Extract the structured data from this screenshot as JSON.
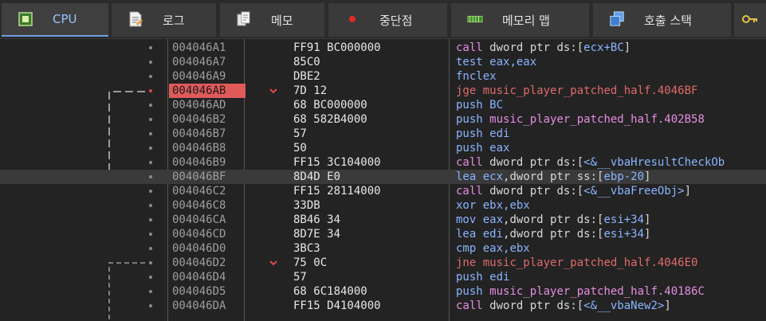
{
  "tabs": [
    {
      "label": "CPU",
      "icon": "cpu-icon"
    },
    {
      "label": "로그",
      "icon": "log-icon"
    },
    {
      "label": "메모",
      "icon": "notes-icon"
    },
    {
      "label": "중단점",
      "icon": "breakpoint-icon"
    },
    {
      "label": "메모리 맵",
      "icon": "memory-map-icon"
    },
    {
      "label": "호출 스택",
      "icon": "call-stack-icon"
    }
  ],
  "active_tab": "CPU",
  "colors": {
    "accent": "#6d9ee6",
    "breakpoint": "#e15a5a",
    "call": "#e58de0",
    "jump": "#e06a6a",
    "mnemonic": "#8ab4ff"
  },
  "rows": [
    {
      "addr": "004046A1",
      "bytes": "FF91 BC000000",
      "mn": "call",
      "mn_class": "m-call",
      "ops": [
        {
          "t": "dword ptr ",
          "c": "kw"
        },
        {
          "t": "ds",
          "c": "seg"
        },
        {
          "t": ":[",
          "c": "br"
        },
        {
          "t": "ecx+BC",
          "c": "opnd"
        },
        {
          "t": "]",
          "c": "br"
        }
      ]
    },
    {
      "addr": "004046A7",
      "bytes": "85C0",
      "mn": "test",
      "mn_class": "m-norm",
      "ops": [
        {
          "t": "eax,eax",
          "c": "opnd"
        }
      ]
    },
    {
      "addr": "004046A9",
      "bytes": "DBE2",
      "mn": "fnclex",
      "mn_class": "m-norm",
      "ops": []
    },
    {
      "addr": "004046AB",
      "bytes": "7D 12",
      "mn": "jge",
      "mn_class": "m-jcc",
      "ops": [
        {
          "t": "music_player_patched_half.4046BF",
          "c": "m-jcc"
        }
      ],
      "breakpoint": true,
      "jump": true
    },
    {
      "addr": "004046AD",
      "bytes": "68 BC000000",
      "mn": "push",
      "mn_class": "m-norm",
      "ops": [
        {
          "t": "BC",
          "c": "opnd"
        }
      ]
    },
    {
      "addr": "004046B2",
      "bytes": "68 582B4000",
      "mn": "push",
      "mn_class": "m-norm",
      "ops": [
        {
          "t": "music_player_patched_half.402B58",
          "c": "m-call"
        }
      ]
    },
    {
      "addr": "004046B7",
      "bytes": "57",
      "mn": "push",
      "mn_class": "m-norm",
      "ops": [
        {
          "t": "edi",
          "c": "opnd"
        }
      ]
    },
    {
      "addr": "004046B8",
      "bytes": "50",
      "mn": "push",
      "mn_class": "m-norm",
      "ops": [
        {
          "t": "eax",
          "c": "opnd"
        }
      ]
    },
    {
      "addr": "004046B9",
      "bytes": "FF15 3C104000",
      "mn": "call",
      "mn_class": "m-call",
      "ops": [
        {
          "t": "dword ptr ",
          "c": "kw"
        },
        {
          "t": "ds",
          "c": "seg"
        },
        {
          "t": ":[",
          "c": "br"
        },
        {
          "t": "<&__vbaHresultCheckOb",
          "c": "opnd"
        }
      ]
    },
    {
      "addr": "004046BF",
      "bytes": "8D4D E0",
      "mn": "lea",
      "mn_class": "m-norm",
      "ops": [
        {
          "t": "ecx",
          "c": "opnd"
        },
        {
          "t": ",dword ptr ",
          "c": "kw"
        },
        {
          "t": "ss",
          "c": "seg"
        },
        {
          "t": ":[",
          "c": "br"
        },
        {
          "t": "ebp-20",
          "c": "opnd"
        },
        {
          "t": "]",
          "c": "br"
        }
      ],
      "current": true
    },
    {
      "addr": "004046C2",
      "bytes": "FF15 28114000",
      "mn": "call",
      "mn_class": "m-call",
      "ops": [
        {
          "t": "dword ptr ",
          "c": "kw"
        },
        {
          "t": "ds",
          "c": "seg"
        },
        {
          "t": ":[",
          "c": "br"
        },
        {
          "t": "<&__vbaFreeObj>",
          "c": "opnd"
        },
        {
          "t": "]",
          "c": "br"
        }
      ]
    },
    {
      "addr": "004046C8",
      "bytes": "33DB",
      "mn": "xor",
      "mn_class": "m-norm",
      "ops": [
        {
          "t": "ebx,ebx",
          "c": "opnd"
        }
      ]
    },
    {
      "addr": "004046CA",
      "bytes": "8B46 34",
      "mn": "mov",
      "mn_class": "m-norm",
      "ops": [
        {
          "t": "eax",
          "c": "opnd"
        },
        {
          "t": ",dword ptr ",
          "c": "kw"
        },
        {
          "t": "ds",
          "c": "seg"
        },
        {
          "t": ":[",
          "c": "br"
        },
        {
          "t": "esi+34",
          "c": "opnd"
        },
        {
          "t": "]",
          "c": "br"
        }
      ]
    },
    {
      "addr": "004046CD",
      "bytes": "8D7E 34",
      "mn": "lea",
      "mn_class": "m-norm",
      "ops": [
        {
          "t": "edi",
          "c": "opnd"
        },
        {
          "t": ",dword ptr ",
          "c": "kw"
        },
        {
          "t": "ds",
          "c": "seg"
        },
        {
          "t": ":[",
          "c": "br"
        },
        {
          "t": "esi+34",
          "c": "opnd"
        },
        {
          "t": "]",
          "c": "br"
        }
      ]
    },
    {
      "addr": "004046D0",
      "bytes": "3BC3",
      "mn": "cmp",
      "mn_class": "m-norm",
      "ops": [
        {
          "t": "eax,ebx",
          "c": "opnd"
        }
      ]
    },
    {
      "addr": "004046D2",
      "bytes": "75 0C",
      "mn": "jne",
      "mn_class": "m-jcc",
      "ops": [
        {
          "t": "music_player_patched_half.4046E0",
          "c": "m-jcc"
        }
      ],
      "jump": true
    },
    {
      "addr": "004046D4",
      "bytes": "57",
      "mn": "push",
      "mn_class": "m-norm",
      "ops": [
        {
          "t": "edi",
          "c": "opnd"
        }
      ]
    },
    {
      "addr": "004046D5",
      "bytes": "68 6C184000",
      "mn": "push",
      "mn_class": "m-norm",
      "ops": [
        {
          "t": "music_player_patched_half.40186C",
          "c": "m-call"
        }
      ]
    },
    {
      "addr": "004046DA",
      "bytes": "FF15 D4104000",
      "mn": "call",
      "mn_class": "m-call",
      "ops": [
        {
          "t": "dword ptr ",
          "c": "kw"
        },
        {
          "t": "ds",
          "c": "seg"
        },
        {
          "t": ":[",
          "c": "br"
        },
        {
          "t": "<&__vbaNew2>",
          "c": "opnd"
        },
        {
          "t": "]",
          "c": "br"
        }
      ]
    }
  ]
}
